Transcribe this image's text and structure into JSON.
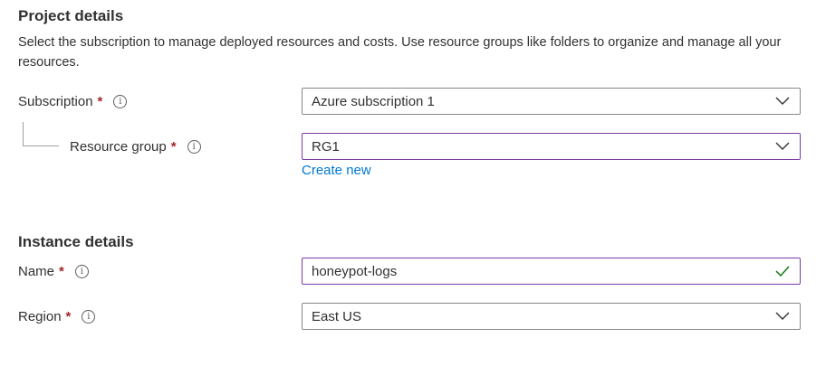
{
  "project": {
    "title": "Project details",
    "description": "Select the subscription to manage deployed resources and costs. Use resource groups like folders to organize and manage all your resources."
  },
  "subscription": {
    "label": "Subscription",
    "required_mark": "*",
    "info_icon": "i",
    "value": "Azure subscription 1"
  },
  "resource_group": {
    "label": "Resource group",
    "required_mark": "*",
    "info_icon": "i",
    "value": "RG1",
    "create_new_link": "Create new"
  },
  "instance": {
    "title": "Instance details"
  },
  "name": {
    "label": "Name",
    "required_mark": "*",
    "info_icon": "i",
    "value": "honeypot-logs",
    "validation": "valid"
  },
  "region": {
    "label": "Region",
    "required_mark": "*",
    "info_icon": "i",
    "value": "East US"
  },
  "colors": {
    "focus_border": "#7c3aa6",
    "link": "#0078d4",
    "required": "#a4262c",
    "check": "#107c10"
  }
}
